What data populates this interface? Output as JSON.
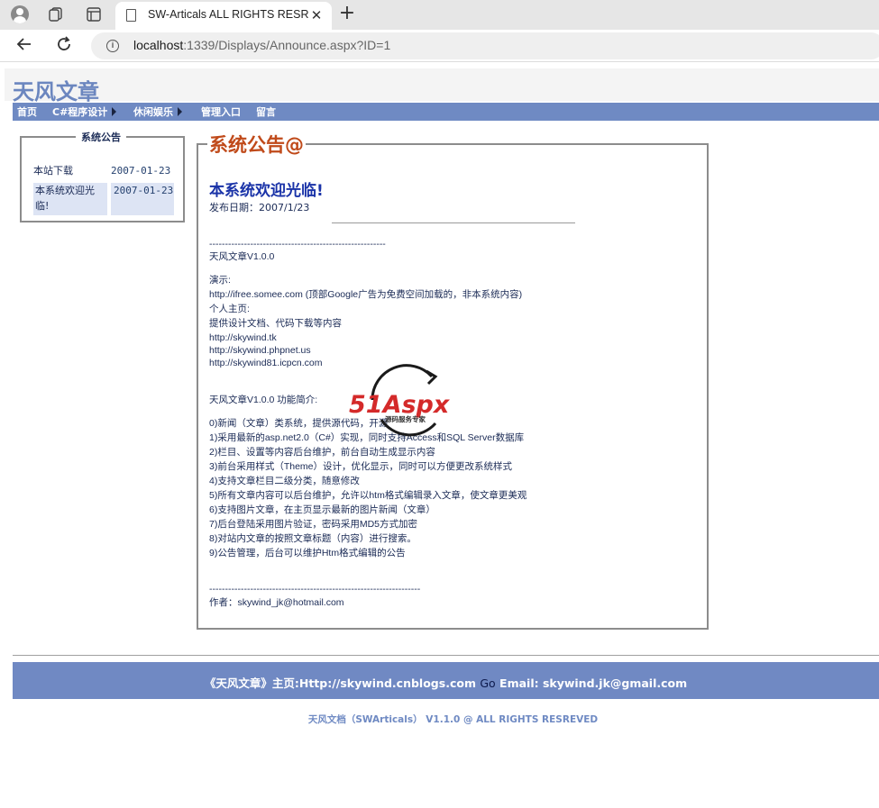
{
  "browser": {
    "tab_title": "SW-Articals ALL RIGHTS RESREVED",
    "url_host": "localhost",
    "url_rest": ":1339/Displays/Announce.aspx?ID=1",
    "info_glyph": "i"
  },
  "site": {
    "title": "天风文章",
    "menu": [
      {
        "label": "首页"
      },
      {
        "label": "C#程序设计"
      },
      {
        "label": "休闲娱乐"
      },
      {
        "label": "管理入口"
      },
      {
        "label": "留言"
      }
    ]
  },
  "announcements": {
    "legend": "系统公告",
    "items": [
      {
        "title": "本站下载",
        "date": "2007-01-23"
      },
      {
        "title": "本系统欢迎光临!",
        "date": "2007-01-23"
      }
    ]
  },
  "article": {
    "legend": "系统公告@",
    "title": "本系统欢迎光临!",
    "date_label": "发布日期：2007/1/23",
    "lines": [
      "--------------------------------------------------------",
      "天风文章V1.0.0",
      "演示:",
      " http://ifree.somee.com (顶部Google广告为免费空间加载的，非本系统内容)",
      "个人主页:",
      "  提供设计文档、代码下载等内容",
      " http://skywind.tk",
      " http://skywind.phpnet.us",
      " http://skywind81.icpcn.com",
      "天风文章V1.0.0 功能简介:",
      "0)新闻（文章）类系统，提供源代码，开源",
      "1)采用最新的asp.net2.0（C#）实现，同时支持Access和SQL Server数据库",
      "2)栏目、设置等内容后台维护，前台自动生成显示内容",
      "3)前台采用样式（Theme）设计，优化显示，同时可以方便更改系统样式",
      "4)支持文章栏目二级分类，随意修改",
      "5)所有文章内容可以后台维护，允许以htm格式编辑录入文章，使文章更美观",
      "6)支持图片文章，在主页显示最新的图片新闻（文章）",
      "7)后台登陆采用图片验证，密码采用MD5方式加密",
      "8)对站内文章的按照文章标题（内容）进行搜索。",
      "9)公告管理，后台可以维护Htm格式编辑的公告",
      "-------------------------------------------------------------------",
      "作者：skywind_jk@hotmail.com"
    ]
  },
  "watermark": {
    "logo_text": "51Aspx",
    "tagline": "源码服务专家"
  },
  "footer": {
    "main": "《天风文章》主页:Http://skywind.cnblogs.com",
    "go_link": "Go",
    "email": "Email: skywind.jk@gmail.com",
    "copyright": "天风文档（SWArticals） V1.1.0 @ ALL RIGHTS RESREVED"
  },
  "colors": {
    "menu_bg": "#6f8ac3",
    "title_blue": "#6b86bf",
    "legend_orange": "#c04a1a",
    "article_title": "#1a33a8"
  },
  "icons": [
    "profile-icon",
    "collections-icon",
    "tab-actions-icon",
    "page-icon",
    "close-icon",
    "plus-icon",
    "back-arrow-icon",
    "reload-icon",
    "info-icon"
  ]
}
